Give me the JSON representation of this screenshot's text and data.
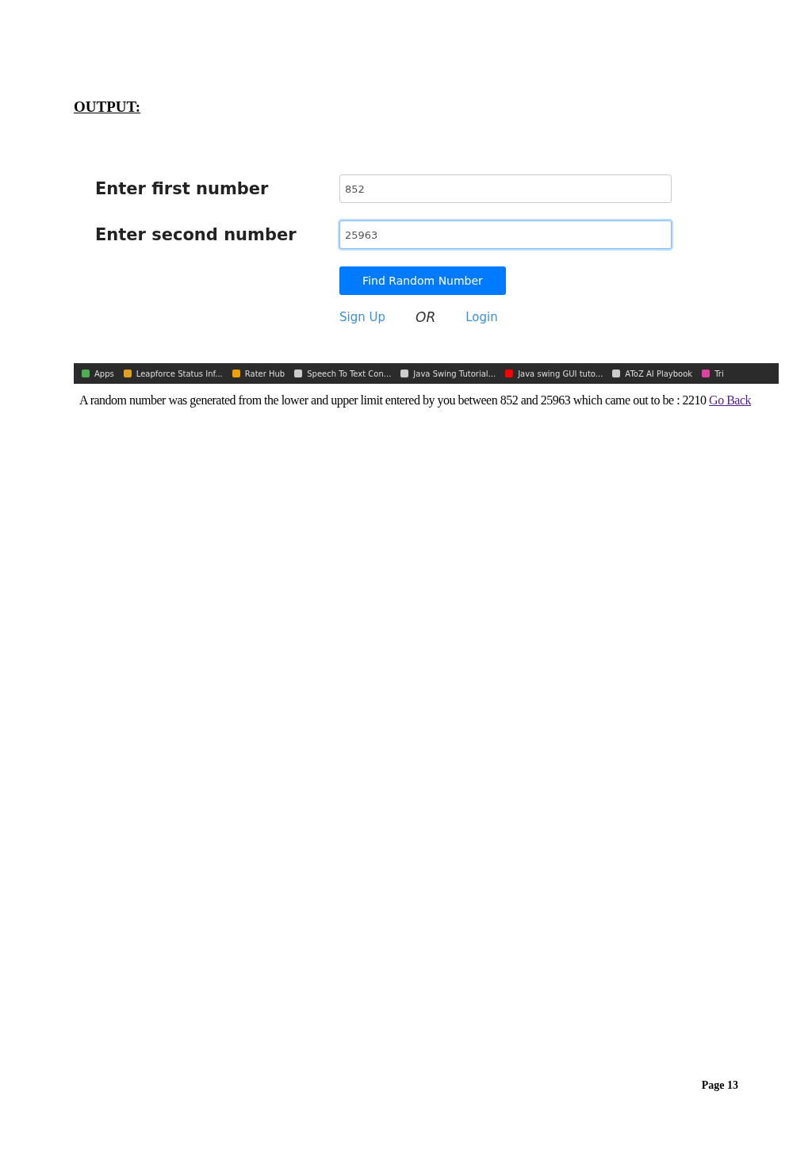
{
  "heading": "OUTPUT:",
  "form": {
    "fields": [
      {
        "label": "Enter first number",
        "value": "852",
        "focused": false
      },
      {
        "label": "Enter second number",
        "value": "25963",
        "focused": true
      }
    ],
    "button": "Find Random Number",
    "links": [
      {
        "kind": "link",
        "text": "Sign Up"
      },
      {
        "kind": "separator",
        "text": "OR"
      },
      {
        "kind": "link",
        "text": "Login"
      }
    ]
  },
  "bookmarks_bar": {
    "items": [
      {
        "text": "Apps",
        "color": "#4caf50"
      },
      {
        "text": "Leapforce Status Inf...",
        "color": "#e0a020"
      },
      {
        "text": "Rater Hub",
        "color": "#f0a000"
      },
      {
        "text": "Speech To Text Con...",
        "color": "#cccccc"
      },
      {
        "text": "Java Swing Tutorial...",
        "color": "#cccccc"
      },
      {
        "text": "Java swing GUI tuto...",
        "color": "#ff0000"
      },
      {
        "text": "AToZ AI Playbook",
        "color": "#cccccc"
      },
      {
        "text": "Tri",
        "color": "#e040a0"
      }
    ]
  },
  "result": {
    "text": "A random number was generated from the lower and upper limit entered by you between 852 and 25963 which came out to be : 2210",
    "link": "Go Back"
  },
  "footer": "Page 13"
}
